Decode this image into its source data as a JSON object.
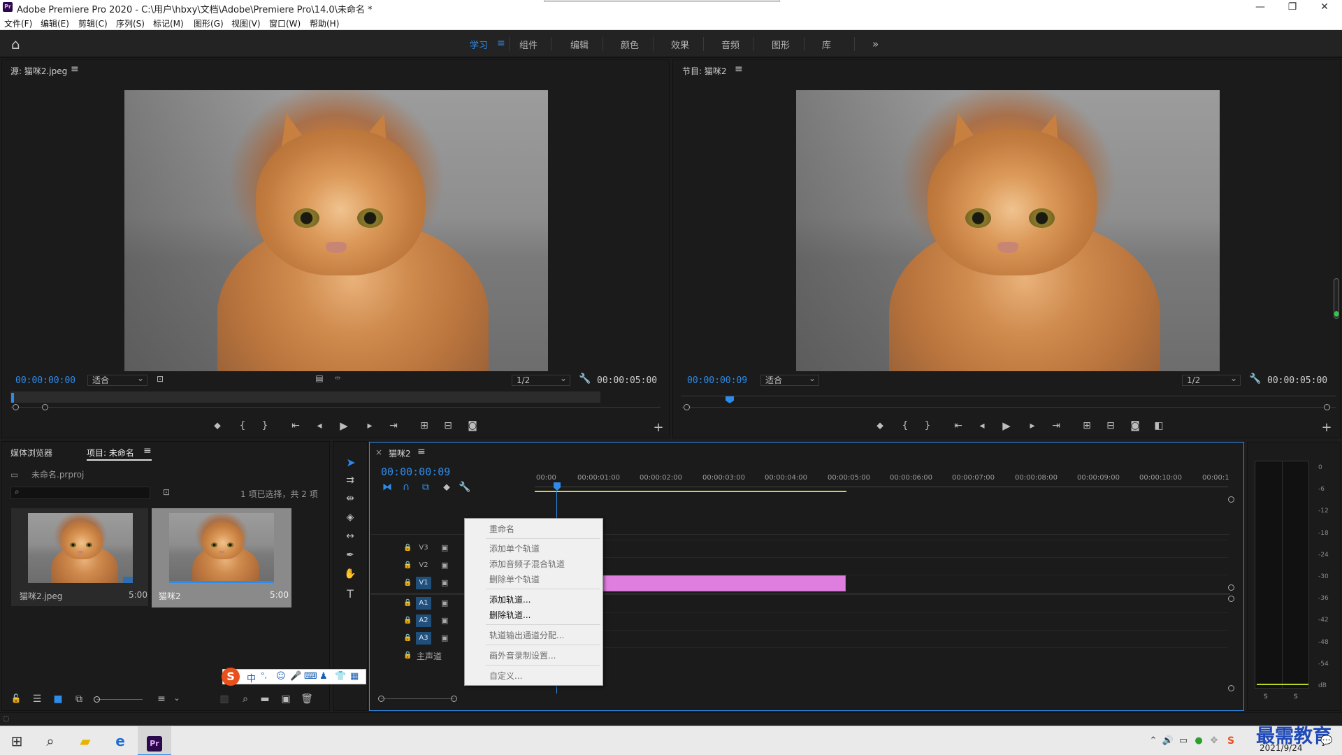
{
  "window": {
    "title": "Adobe Premiere Pro 2020 - C:\\用户\\hbxy\\文档\\Adobe\\Premiere Pro\\14.0\\未命名 *",
    "app_badge": "Pr"
  },
  "menu": [
    "文件(F)",
    "编辑(E)",
    "剪辑(C)",
    "序列(S)",
    "标记(M)",
    "图形(G)",
    "视图(V)",
    "窗口(W)",
    "帮助(H)"
  ],
  "workspaces": [
    "学习",
    "组件",
    "编辑",
    "颜色",
    "效果",
    "音频",
    "图形",
    "库"
  ],
  "workspaces_more": "»",
  "source": {
    "title": "源: 猫咪2.jpeg",
    "timecode": "00:00:00:00",
    "fit": "适合",
    "resolution": "1/2",
    "duration": "00:00:05:00"
  },
  "program": {
    "title": "节目: 猫咪2",
    "timecode": "00:00:00:09",
    "fit": "适合",
    "resolution": "1/2",
    "duration": "00:00:05:00"
  },
  "project": {
    "tabs": [
      "媒体浏览器",
      "项目: 未命名"
    ],
    "file": "未命名.prproj",
    "selection_info": "1 项已选择，共 2 项",
    "items": [
      {
        "name": "猫咪2.jpeg",
        "duration": "5:00"
      },
      {
        "name": "猫咪2",
        "duration": "5:00"
      }
    ]
  },
  "timeline": {
    "tab": "猫咪2",
    "timecode": "00:00:00:09",
    "ruler": [
      "00:00",
      "00:00:01:00",
      "00:00:02:00",
      "00:00:03:00",
      "00:00:04:00",
      "00:00:05:00",
      "00:00:06:00",
      "00:00:07:00",
      "00:00:08:00",
      "00:00:09:00",
      "00:00:10:00",
      "00:00:1"
    ],
    "video_tracks": [
      "V3",
      "V2",
      "V1"
    ],
    "audio_tracks": [
      "A1",
      "A2",
      "A3"
    ],
    "master": "主声道"
  },
  "context_menu": [
    {
      "label": "重命名",
      "enabled": false
    },
    {
      "label": "添加单个轨道",
      "enabled": false
    },
    {
      "label": "添加音频子混合轨道",
      "enabled": false
    },
    {
      "label": "删除单个轨道",
      "enabled": false
    },
    {
      "label": "添加轨道...",
      "enabled": true
    },
    {
      "label": "删除轨道...",
      "enabled": true
    },
    {
      "label": "轨道输出通道分配...",
      "enabled": false
    },
    {
      "label": "画外音录制设置...",
      "enabled": false
    },
    {
      "label": "自定义...",
      "enabled": false
    }
  ],
  "meter": {
    "scale": [
      "0",
      "-6",
      "-12",
      "-18",
      "-24",
      "-30",
      "-36",
      "-42",
      "-48",
      "-54",
      "dB"
    ],
    "solo": [
      "S",
      "S"
    ]
  },
  "ime": [
    "中",
    "°,"
  ],
  "taskbar": {
    "date": "2021/9/24",
    "watermark": "最需教育"
  },
  "colors": {
    "accent": "#2d8ceb",
    "clip": "#e07ee0",
    "workarea": "#d9d920"
  }
}
